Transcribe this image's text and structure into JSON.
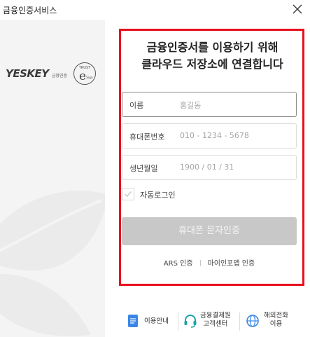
{
  "window": {
    "title": "금융인증서비스",
    "close_icon": "close-icon"
  },
  "brand": {
    "logo_text": "YESKEY",
    "logo_subtext": "금융인증",
    "seal_text_top": "TRUST",
    "seal_letter": "e",
    "seal_text_bottom": "Sign"
  },
  "heading": {
    "line1": "금융인증서를 이용하기 위해",
    "line2": "클라우드 저장소에 연결합니다"
  },
  "form": {
    "name_label": "이름",
    "name_placeholder": "홍길동",
    "phone_label": "휴대폰번호",
    "phone_placeholder": "010 - 1234 - 5678",
    "birth_label": "생년월일",
    "birth_placeholder": "1900 / 01 / 31",
    "auto_login_label": "자동로그인",
    "auto_login_checked": true
  },
  "actions": {
    "sms_button": "휴대폰 문자인증",
    "ars_link": "ARS 인증",
    "mydata_link": "마이인포앱 인증"
  },
  "footer": {
    "guide": "이용안내",
    "support_line1": "금융결제원",
    "support_line2": "고객센터",
    "overseas_line1": "해외전화",
    "overseas_line2": "이용"
  },
  "colors": {
    "highlight_border": "#e8101e",
    "button_disabled": "#c8c8c8",
    "icon_blue": "#3a86e6",
    "icon_teal": "#1aa3a8"
  }
}
